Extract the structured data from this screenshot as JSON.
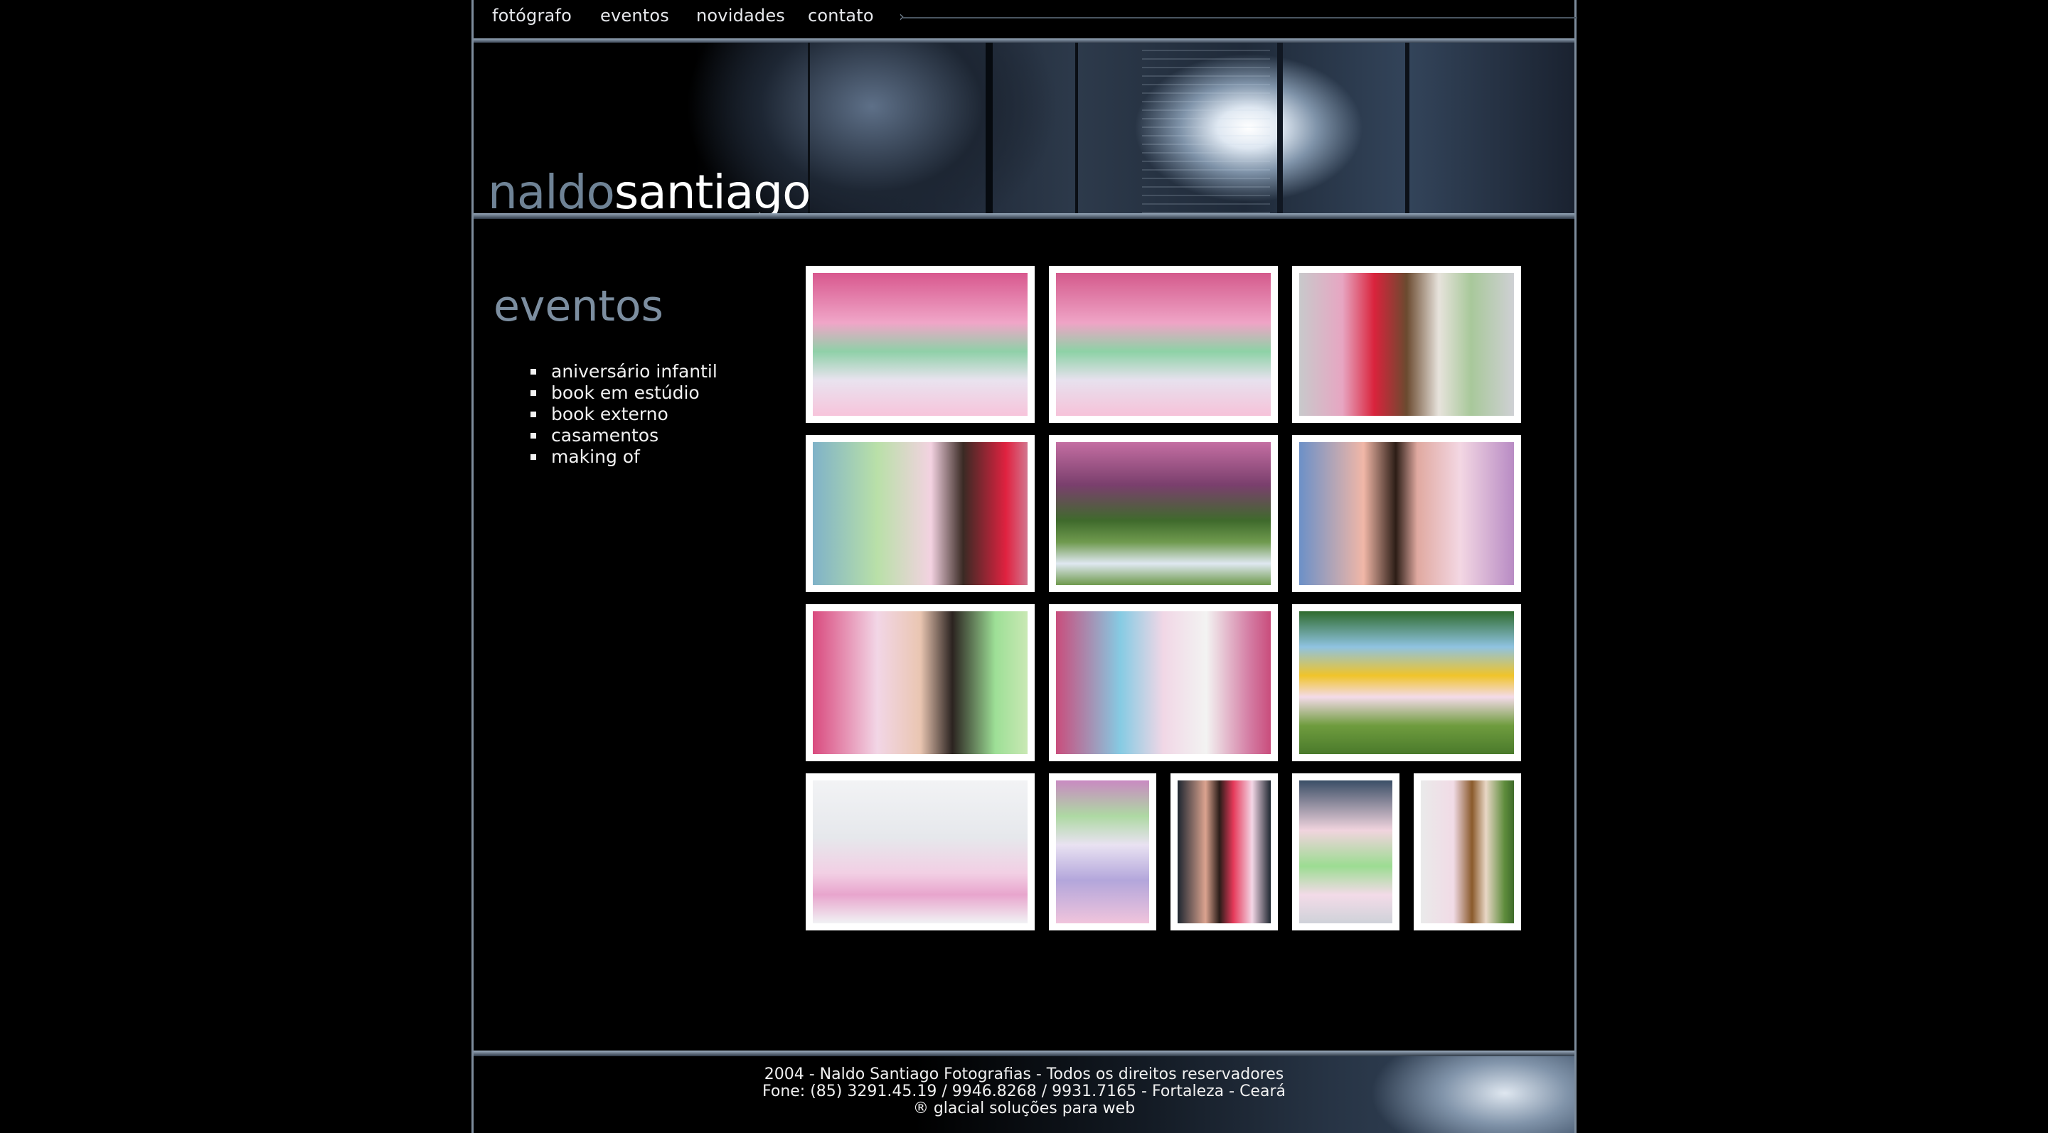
{
  "nav": {
    "items": [
      "fotógrafo",
      "eventos",
      "novidades",
      "contato"
    ]
  },
  "brand": {
    "first": "naldo",
    "second": "santiago"
  },
  "sidebar": {
    "heading": "eventos",
    "items": [
      "aniversário infantil",
      "book em estúdio",
      "book externo",
      "casamentos",
      "making of"
    ]
  },
  "gallery": {
    "photos": [
      "party-group-cake-1",
      "party-group-cake-2",
      "couple-with-portrait",
      "parents-with-baby",
      "two-girls-on-lawn",
      "mother-with-baby",
      "father-with-baby",
      "grandparents-with-baby",
      "baby-in-toy-car",
      "baby-on-white-sofa",
      "baby-by-cake",
      "mother-holding-baby",
      "father-holding-baby",
      "baby-with-easel-portrait"
    ]
  },
  "footer": {
    "line1": "2004 - Naldo Santiago Fotografias - Todos os direitos reservadores",
    "line2": "Fone: (85) 3291.45.19 / 9946.8268 / 9931.7165 - Fortaleza - Ceará",
    "line3": "® glacial soluções para web"
  },
  "colors": {
    "background": "#000000",
    "accent": "#7c8ea0",
    "frame": "#7d8c9c"
  }
}
